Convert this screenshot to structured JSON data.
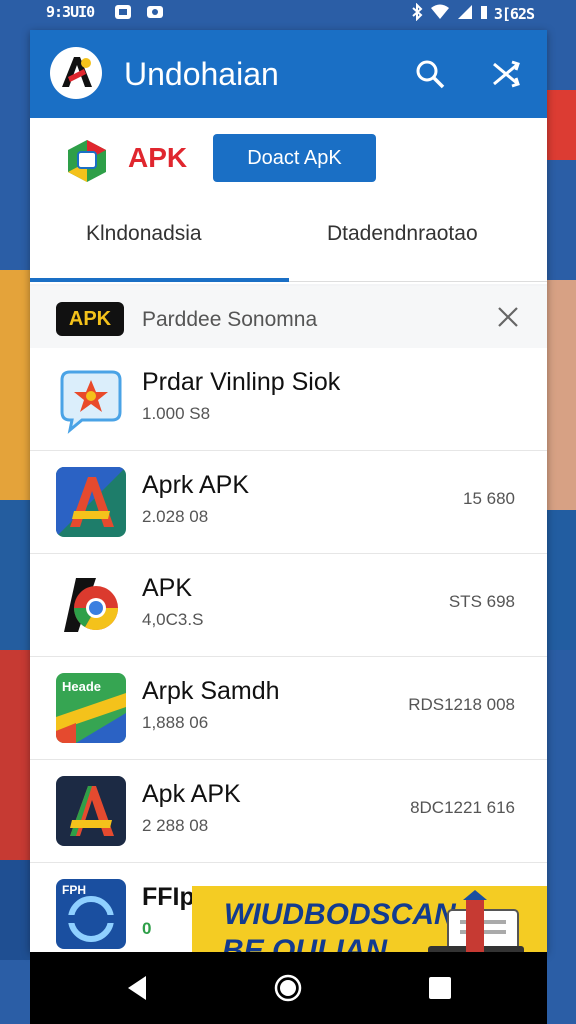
{
  "status_bar": {
    "time": "9:3UI0",
    "battery": "3[62S",
    "icons": [
      "image-icon",
      "camera-icon",
      "bluetooth-icon",
      "wifi-icon",
      "signal-icon",
      "battery-icon"
    ]
  },
  "app_bar": {
    "title": "Undohaian",
    "icons": [
      "app-logo-icon",
      "search-icon",
      "shuffle-icon"
    ]
  },
  "brand": {
    "apk_label": "APK",
    "download_button": "Doact ApK"
  },
  "tabs": [
    {
      "label": "Klndonadsia",
      "selected": true
    },
    {
      "label": "Dtadendnraotao",
      "selected": false
    }
  ],
  "search": {
    "chip": "APK",
    "query": "Parddee Sonomna"
  },
  "apps": [
    {
      "name": "Prdar Vinlinp Siok",
      "sub": "1.000 S8",
      "size": "",
      "icon": "star-bubble-icon"
    },
    {
      "name": "Aprk APK",
      "sub": "2.028 08",
      "size": "15 680",
      "icon": "a-logo-icon"
    },
    {
      "name": "APK",
      "sub": "4,0C3.S",
      "size": "STS 698",
      "icon": "chrome-icon"
    },
    {
      "name": "Arpk Samdh",
      "sub": "1,888 06",
      "size": "RDS1218 008",
      "icon": "maps-icon"
    },
    {
      "name": "Apk APK",
      "sub": "2 288 08",
      "size": "8DC1221 616",
      "icon": "a-logo-dark-icon"
    },
    {
      "name": "FFIp",
      "sub": "0",
      "size": "",
      "icon": "circle-app-icon",
      "tag": "FPH"
    }
  ],
  "maps_icon_label": "Heade",
  "ad_banner": {
    "line1": "WIUDBODSCAN",
    "line2": "BE OULIAN"
  },
  "nav_bar": [
    "back-icon",
    "home-icon",
    "recents-icon"
  ],
  "colors": {
    "primary": "#1a6fc5",
    "apk_red": "#e0262e",
    "ad_yellow": "#f4cc23"
  }
}
